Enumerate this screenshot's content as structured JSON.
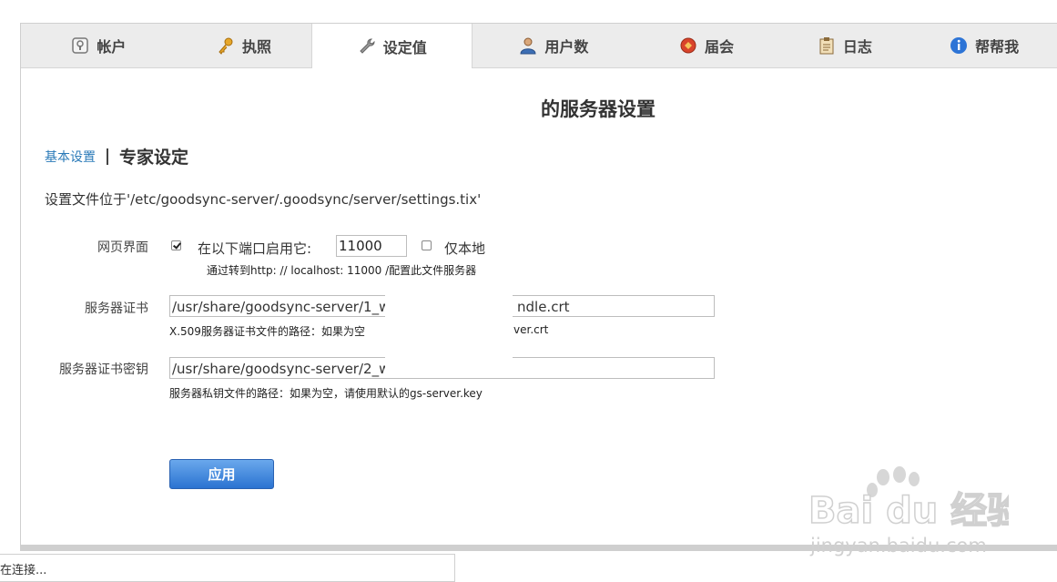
{
  "tabs": [
    {
      "label": "帐户",
      "icon": "account-icon"
    },
    {
      "label": "执照",
      "icon": "key-icon"
    },
    {
      "label": "设定值",
      "icon": "wrench-icon",
      "active": true
    },
    {
      "label": "用户数",
      "icon": "user-icon"
    },
    {
      "label": "届会",
      "icon": "session-icon"
    },
    {
      "label": "日志",
      "icon": "log-icon"
    },
    {
      "label": "帮帮我",
      "icon": "help-icon"
    }
  ],
  "page": {
    "title": "的服务器设置",
    "basic_link": "基本设置",
    "expert_label": "专家设定",
    "settings_path": "设置文件位于'/etc/goodsync-server/.goodsync/server/settings.tix'"
  },
  "web_ui": {
    "label": "网页界面",
    "enabled": true,
    "enable_text": "在以下端口启用它:",
    "port": "11000",
    "local_only": false,
    "local_only_label": "仅本地",
    "hint": "通过转到http: // localhost: 11000 /配置此文件服务器"
  },
  "server_cert": {
    "label": "服务器证书",
    "value_visible_start": "/usr/share/goodsync-server/1_w",
    "value_visible_end": "ndle.crt",
    "hint_start": "X.509服务器证书文件的路径：如果为空",
    "hint_end": "ver.crt"
  },
  "server_cert_key": {
    "label": "服务器证书密钥",
    "value_visible_start": "/usr/share/goodsync-server/2_w",
    "hint": "服务器私钥文件的路径：如果为空，请使用默认的gs-server.key"
  },
  "apply_button": "应用",
  "status_bar": "在连接...",
  "watermark": {
    "line1": "Bai du 经验",
    "line2": "jingyan.baidu.com"
  },
  "colors": {
    "accent": "#2b73d1",
    "link": "#2a7ab8"
  }
}
